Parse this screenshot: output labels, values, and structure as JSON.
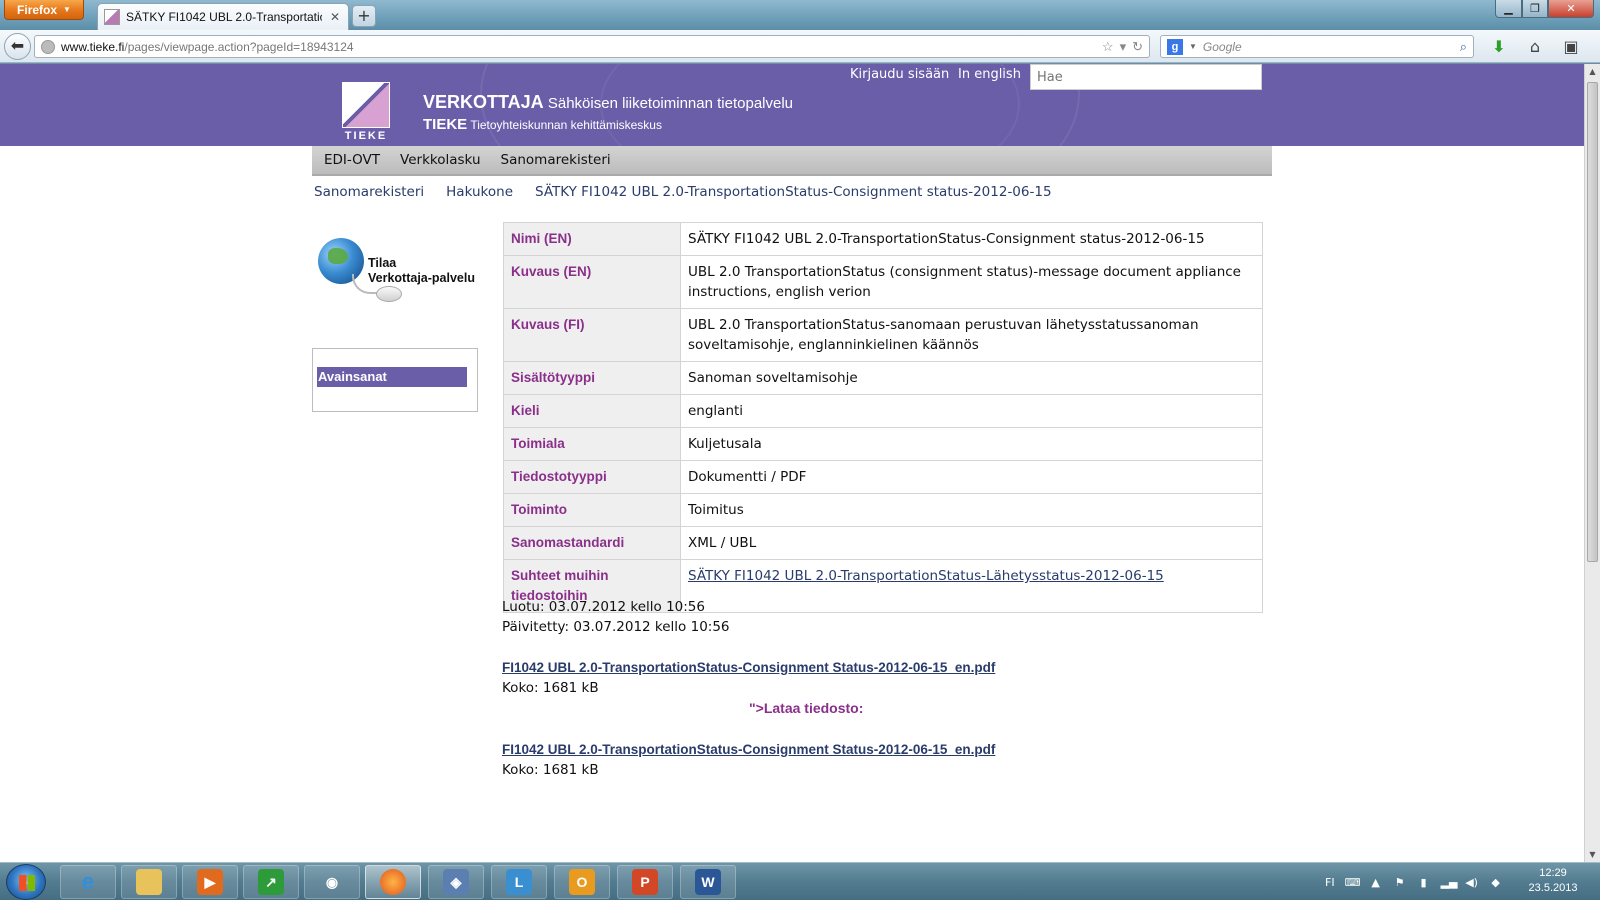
{
  "browser": {
    "app_button": "Firefox",
    "tab_title": "SÄTKY FI1042 UBL 2.0-TransportationSta...",
    "url_host": "www.tieke.fi",
    "url_path": "/pages/viewpage.action?pageId=18943124",
    "search_engine": "Google",
    "search_placeholder": "Google"
  },
  "header": {
    "logo_text": "TIEKE",
    "brand_name": "VERKOTTAJA",
    "brand_tagline": "Sähköisen liiketoiminnan tietopalvelu",
    "org_name": "TIEKE",
    "org_tagline": "Tietoyhteiskunnan kehittämiskeskus",
    "login": "Kirjaudu sisään",
    "language": "In english",
    "search_placeholder": "Hae"
  },
  "menu": [
    "EDI-OVT",
    "Verkkolasku",
    "Sanomarekisteri"
  ],
  "breadcrumb": [
    "Sanomarekisteri",
    "Hakukone",
    "SÄTKY FI1042 UBL 2.0-TransportationStatus-Consignment status-2012-06-15"
  ],
  "sidebar": {
    "promo_line1": "Tilaa",
    "promo_line2": "Verkottaja-palvelu",
    "keywords_title": "Avainsanat"
  },
  "metadata": [
    {
      "key": "Nimi (EN)",
      "value": "SÄTKY FI1042 UBL 2.0-TransportationStatus-Consignment status-2012-06-15"
    },
    {
      "key": "Kuvaus (EN)",
      "value": "UBL 2.0 TransportationStatus (consignment status)-message document appliance instructions, english verion"
    },
    {
      "key": "Kuvaus (FI)",
      "value": "UBL 2.0 TransportationStatus-sanomaan perustuvan lähetysstatussanoman soveltamisohje, englanninkielinen käännös"
    },
    {
      "key": "Sisältötyyppi",
      "value": "Sanoman soveltamisohje"
    },
    {
      "key": "Kieli",
      "value": "englanti"
    },
    {
      "key": "Toimiala",
      "value": "Kuljetusala"
    },
    {
      "key": "Tiedostotyyppi",
      "value": "Dokumentti / PDF"
    },
    {
      "key": "Toiminto",
      "value": "Toimitus"
    },
    {
      "key": "Sanomastandardi",
      "value": "XML / UBL"
    },
    {
      "key": "Suhteet muihin tiedostoihin",
      "value": "SÄTKY FI1042 UBL 2.0-TransportationStatus-Lähetysstatus-2012-06-15",
      "is_link": true
    }
  ],
  "dates": {
    "created": "Luotu: 03.07.2012 kello 10:56",
    "updated": "Päivitetty: 03.07.2012 kello 10:56"
  },
  "files": [
    {
      "name": "FI1042 UBL 2.0-TransportationStatus-Consignment Status-2012-06-15_en.pdf",
      "size": "Koko: 1681 kB"
    },
    {
      "name": "FI1042 UBL 2.0-TransportationStatus-Consignment Status-2012-06-15_en.pdf",
      "size": "Koko: 1681 kB"
    }
  ],
  "download_label": "\">Lataa tiedosto:",
  "taskbar": {
    "language": "FI",
    "time": "12:29",
    "date": "23.5.2013"
  }
}
